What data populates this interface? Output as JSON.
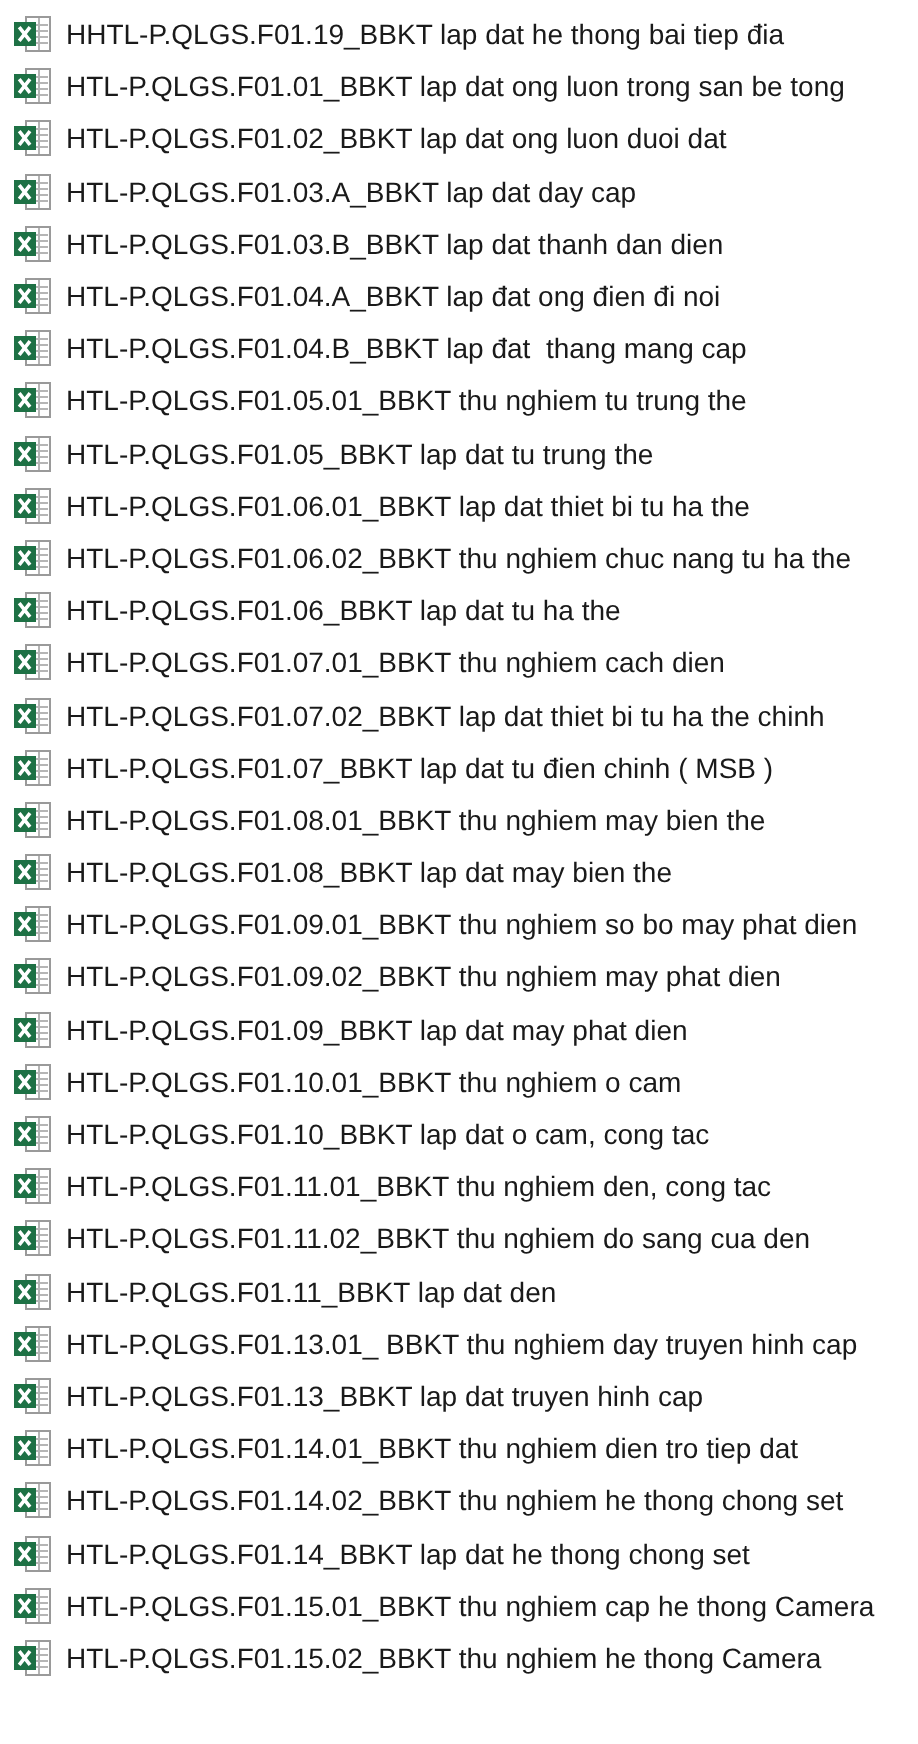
{
  "files": [
    {
      "name": "HHTL-P.QLGS.F01.19_BBKT lap dat he thong bai tiep đia"
    },
    {
      "name": "HTL-P.QLGS.F01.01_BBKT lap dat ong luon trong san be tong"
    },
    {
      "name": "HTL-P.QLGS.F01.02_BBKT lap dat ong luon duoi dat"
    },
    {
      "name": "HTL-P.QLGS.F01.03.A_BBKT lap dat day cap"
    },
    {
      "name": "HTL-P.QLGS.F01.03.B_BBKT lap dat thanh dan dien"
    },
    {
      "name": "HTL-P.QLGS.F01.04.A_BBKT lap đat ong đien đi noi"
    },
    {
      "name": "HTL-P.QLGS.F01.04.B_BBKT lap đat  thang mang cap"
    },
    {
      "name": "HTL-P.QLGS.F01.05.01_BBKT thu nghiem tu trung the"
    },
    {
      "name": "HTL-P.QLGS.F01.05_BBKT lap dat tu trung the"
    },
    {
      "name": "HTL-P.QLGS.F01.06.01_BBKT lap dat thiet bi tu ha the"
    },
    {
      "name": "HTL-P.QLGS.F01.06.02_BBKT thu nghiem chuc nang tu ha the"
    },
    {
      "name": "HTL-P.QLGS.F01.06_BBKT lap dat tu ha the"
    },
    {
      "name": "HTL-P.QLGS.F01.07.01_BBKT thu nghiem cach dien"
    },
    {
      "name": "HTL-P.QLGS.F01.07.02_BBKT lap dat thiet bi tu ha the chinh"
    },
    {
      "name": "HTL-P.QLGS.F01.07_BBKT lap dat tu đien chinh ( MSB )"
    },
    {
      "name": "HTL-P.QLGS.F01.08.01_BBKT thu nghiem may bien the"
    },
    {
      "name": "HTL-P.QLGS.F01.08_BBKT lap dat may bien the"
    },
    {
      "name": "HTL-P.QLGS.F01.09.01_BBKT thu nghiem so bo may phat dien"
    },
    {
      "name": "HTL-P.QLGS.F01.09.02_BBKT thu nghiem may phat dien"
    },
    {
      "name": "HTL-P.QLGS.F01.09_BBKT lap dat may phat dien"
    },
    {
      "name": "HTL-P.QLGS.F01.10.01_BBKT thu nghiem o cam"
    },
    {
      "name": "HTL-P.QLGS.F01.10_BBKT lap dat o cam, cong tac"
    },
    {
      "name": "HTL-P.QLGS.F01.11.01_BBKT thu nghiem den, cong tac"
    },
    {
      "name": "HTL-P.QLGS.F01.11.02_BBKT thu nghiem do sang cua den"
    },
    {
      "name": "HTL-P.QLGS.F01.11_BBKT lap dat den"
    },
    {
      "name": "HTL-P.QLGS.F01.13.01_ BBKT thu nghiem day truyen hinh cap"
    },
    {
      "name": "HTL-P.QLGS.F01.13_BBKT lap dat truyen hinh cap"
    },
    {
      "name": "HTL-P.QLGS.F01.14.01_BBKT thu nghiem dien tro tiep dat"
    },
    {
      "name": "HTL-P.QLGS.F01.14.02_BBKT thu nghiem he thong chong set"
    },
    {
      "name": "HTL-P.QLGS.F01.14_BBKT lap dat he thong chong set"
    },
    {
      "name": "HTL-P.QLGS.F01.15.01_BBKT thu nghiem cap he thong Camera"
    },
    {
      "name": "HTL-P.QLGS.F01.15.02_BBKT thu nghiem he thong Camera"
    }
  ]
}
